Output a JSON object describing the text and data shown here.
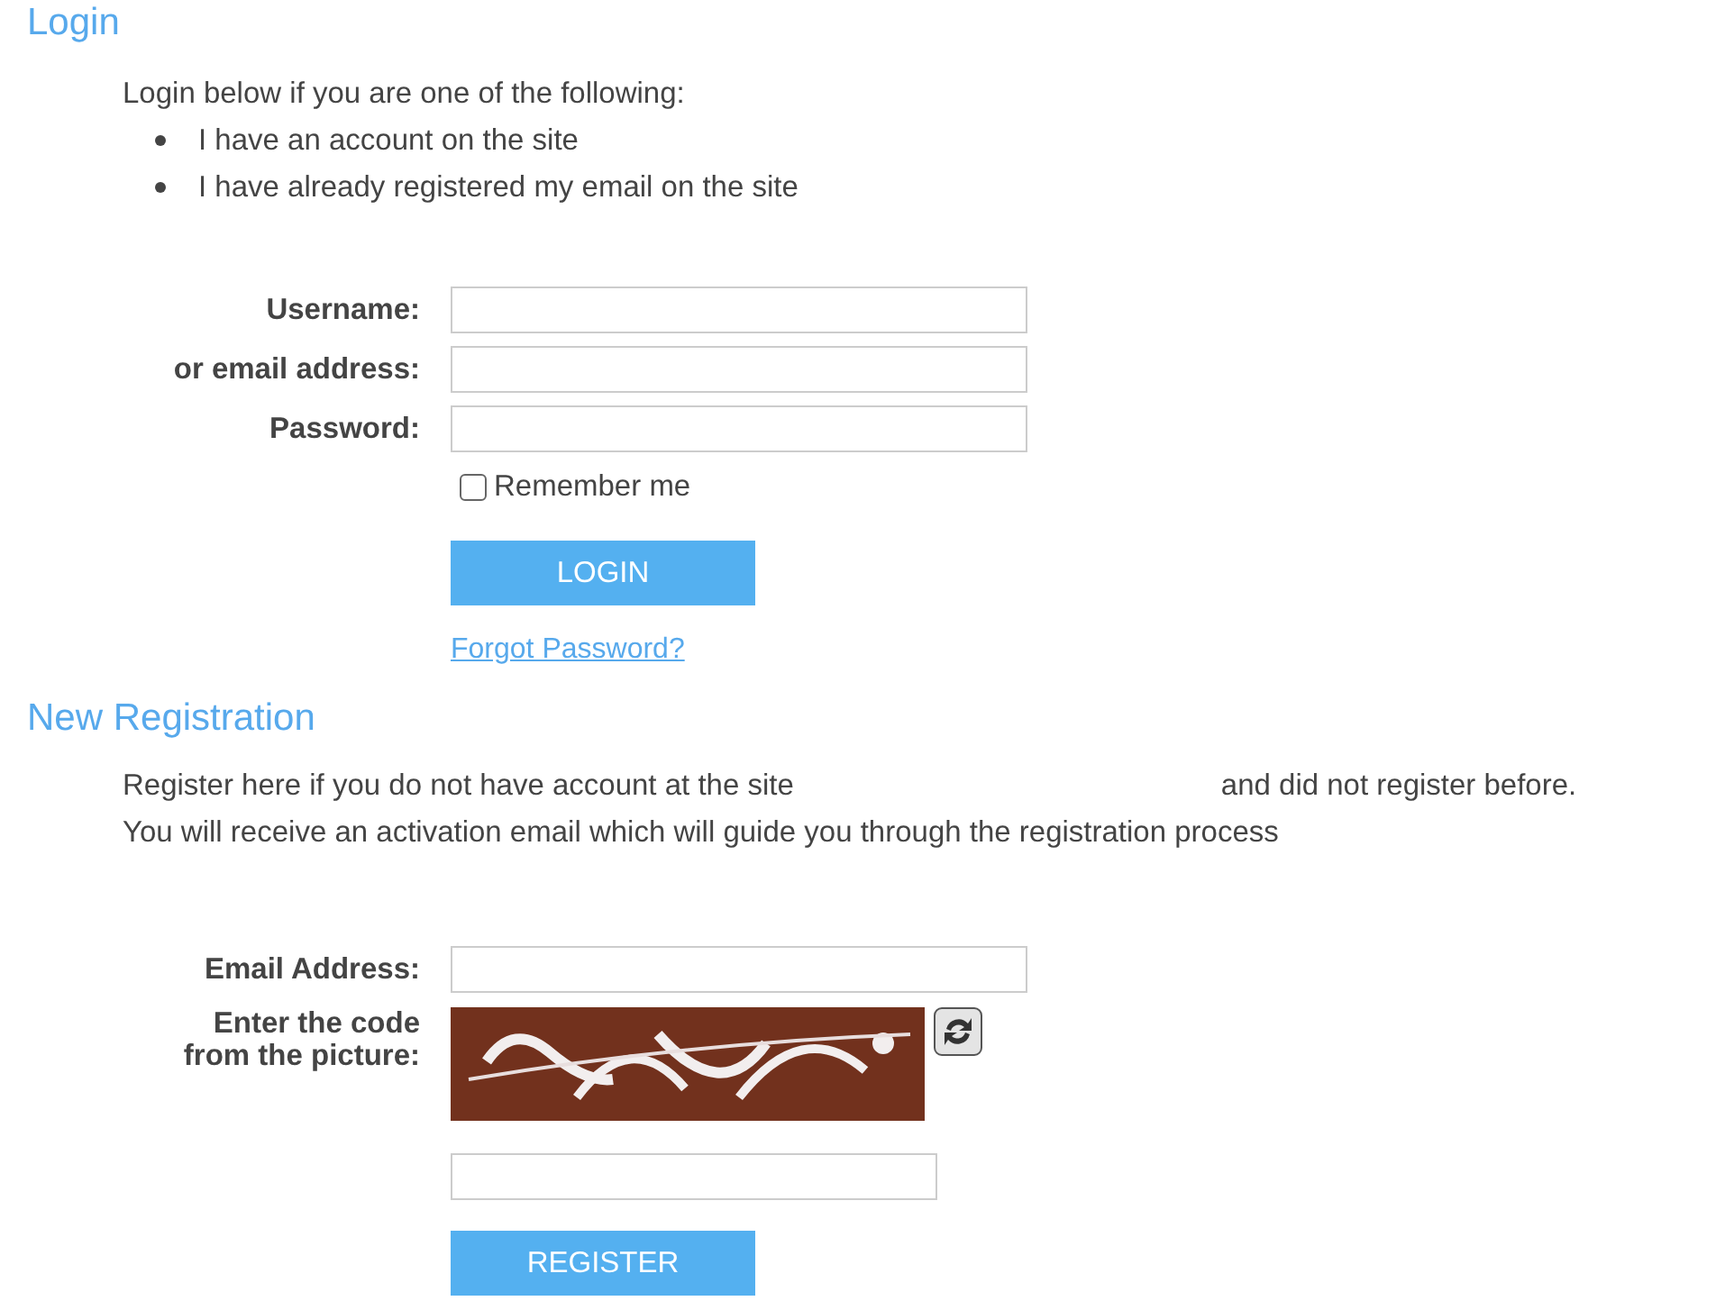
{
  "login": {
    "title": "Login",
    "intro": "Login below if you are one of the following:",
    "bullets": [
      "I have an account on the site",
      "I have already registered my email on the site"
    ],
    "fields": [
      {
        "label": "Username:"
      },
      {
        "label": "or email address:"
      },
      {
        "label": "Password:"
      }
    ],
    "remember": {
      "label": "Remember me",
      "checked": false
    },
    "button": "LOGIN",
    "forgot_link": "Forgot Password?"
  },
  "registration": {
    "title": "New Registration",
    "lines": [
      [
        "Register here if you do not have account at the site",
        "and did not register before."
      ],
      [
        "You will receive an activation email which will guide you through the registration process"
      ]
    ],
    "fields": [
      {
        "label": "Email Address:"
      }
    ],
    "captcha": {
      "label": "Enter the code from the picture:",
      "kind": "picture"
    },
    "button": "REGISTER"
  }
}
